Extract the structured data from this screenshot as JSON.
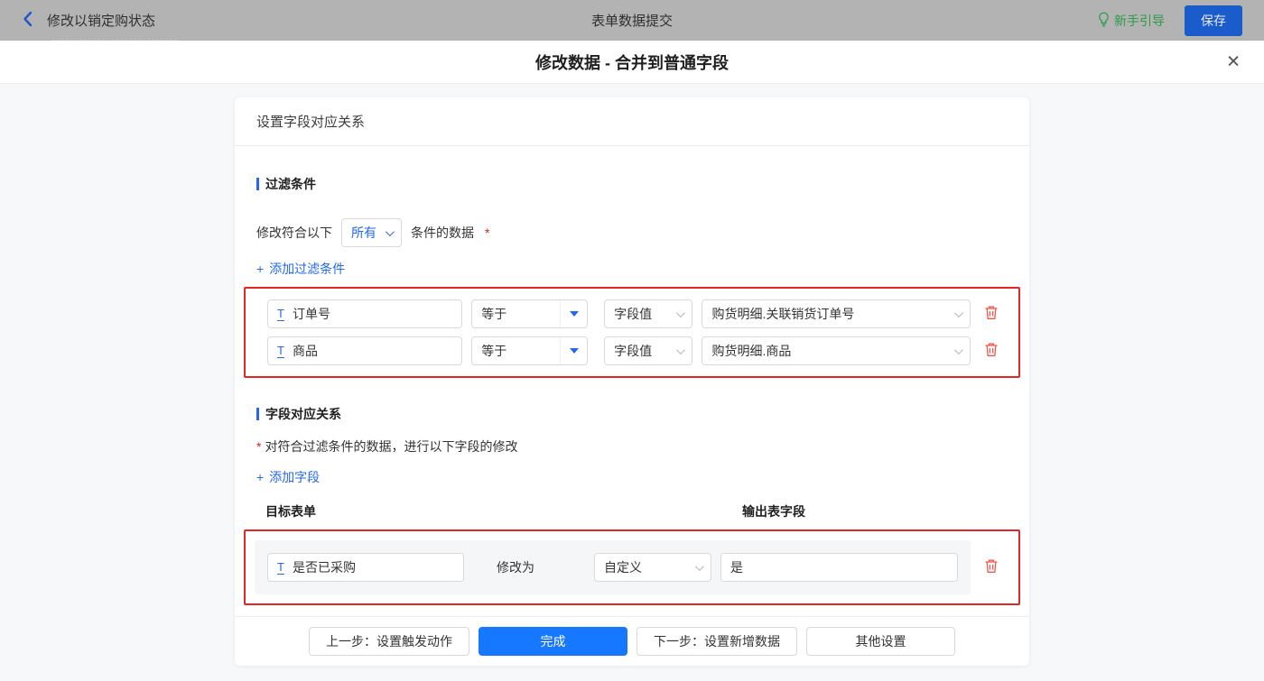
{
  "topbar": {
    "back_label": "修改以销定购状态",
    "center_title": "表单数据提交",
    "guide_label": "新手引导",
    "save_label": "保存"
  },
  "dialog": {
    "title": "修改数据 - 合并到普通字段",
    "close_glyph": "✕"
  },
  "panel": {
    "header": "设置字段对应关系",
    "filter": {
      "section_title": "过滤条件",
      "match_prefix": "修改符合以下",
      "match_value": "所有",
      "match_suffix": "条件的数据",
      "required_mark": "*",
      "plus_glyph": "+",
      "add_label": "添加过滤条件",
      "rows": [
        {
          "field_icon": "T",
          "field": "订单号",
          "operator": "等于",
          "value_type": "字段值",
          "value": "购货明细.关联销货订单号"
        },
        {
          "field_icon": "T",
          "field": "商品",
          "operator": "等于",
          "value_type": "字段值",
          "value": "购货明细.商品"
        }
      ]
    },
    "mapping": {
      "section_title": "字段对应关系",
      "required_mark": "*",
      "description": "对符合过滤条件的数据，进行以下字段的修改",
      "plus_glyph": "+",
      "add_label": "添加字段",
      "col_target": "目标表单",
      "col_output": "输出表字段",
      "rows": [
        {
          "field_icon": "T",
          "field": "是否已采购",
          "action_label": "修改为",
          "value_type": "自定义",
          "value": "是"
        }
      ]
    },
    "footer": {
      "prev": "上一步：设置触发动作",
      "done": "完成",
      "next": "下一步：设置新增数据",
      "other": "其他设置"
    }
  },
  "icons": {
    "back": "chevron-left",
    "guide": "lightbulb",
    "close": "x-mark",
    "field_type": "text-field-T",
    "select_caret": "chevron-down",
    "operator_caret": "filled-triangle-down",
    "trash": "trash-can"
  },
  "colors": {
    "accent_blue": "#2468F2",
    "done_button_blue": "#1677FF",
    "highlight_red": "#E12626",
    "trash_red": "#F0564A",
    "guide_green": "#2C9B4B",
    "topbar_gray": "#B3B3B3",
    "save_button_blue": "#1A5CCC"
  }
}
